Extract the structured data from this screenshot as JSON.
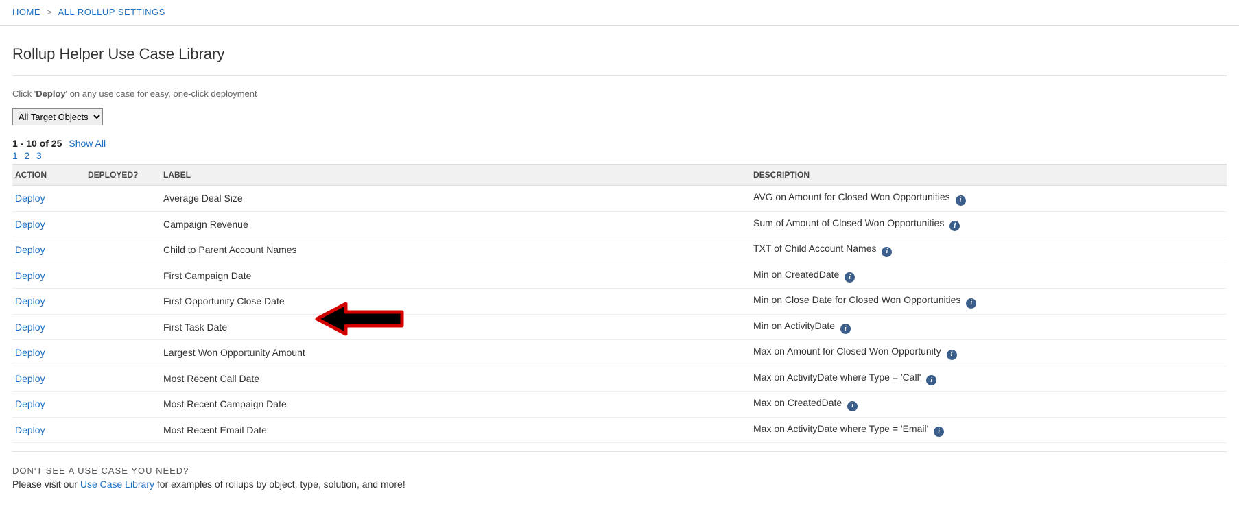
{
  "breadcrumb": {
    "home": "HOME",
    "sep": ">",
    "current": "ALL ROLLUP SETTINGS"
  },
  "title": "Rollup Helper Use Case Library",
  "instruction_prefix": "Click '",
  "instruction_bold": "Deploy",
  "instruction_suffix": "' on any use case for easy, one-click deployment",
  "target_select": {
    "selected": "All Target Objects"
  },
  "pager": {
    "range": "1 - 10 of 25",
    "show_all": "Show All",
    "pages": [
      "1",
      "2",
      "3"
    ]
  },
  "columns": {
    "action": "ACTION",
    "deployed": "DEPLOYED?",
    "label": "LABEL",
    "description": "DESCRIPTION"
  },
  "deploy_label": "Deploy",
  "rows": [
    {
      "label": "Average Deal Size",
      "description": "AVG on Amount for Closed Won Opportunities"
    },
    {
      "label": "Campaign Revenue",
      "description": "Sum of Amount of Closed Won Opportunities"
    },
    {
      "label": "Child to Parent Account Names",
      "description": "TXT of Child Account Names"
    },
    {
      "label": "First Campaign Date",
      "description": "Min on CreatedDate"
    },
    {
      "label": "First Opportunity Close Date",
      "description": "Min on Close Date for Closed Won Opportunities"
    },
    {
      "label": "First Task Date",
      "description": "Min on ActivityDate"
    },
    {
      "label": "Largest Won Opportunity Amount",
      "description": "Max on Amount for Closed Won Opportunity"
    },
    {
      "label": "Most Recent Call Date",
      "description": "Max on ActivityDate where Type = 'Call'"
    },
    {
      "label": "Most Recent Campaign Date",
      "description": "Max on CreatedDate"
    },
    {
      "label": "Most Recent Email Date",
      "description": "Max on ActivityDate where Type = 'Email'"
    }
  ],
  "footer": {
    "heading": "DON'T SEE A USE CASE YOU NEED?",
    "text_prefix": "Please visit our ",
    "link": "Use Case Library",
    "text_suffix": " for examples of rollups by object, type, solution, and more!"
  }
}
